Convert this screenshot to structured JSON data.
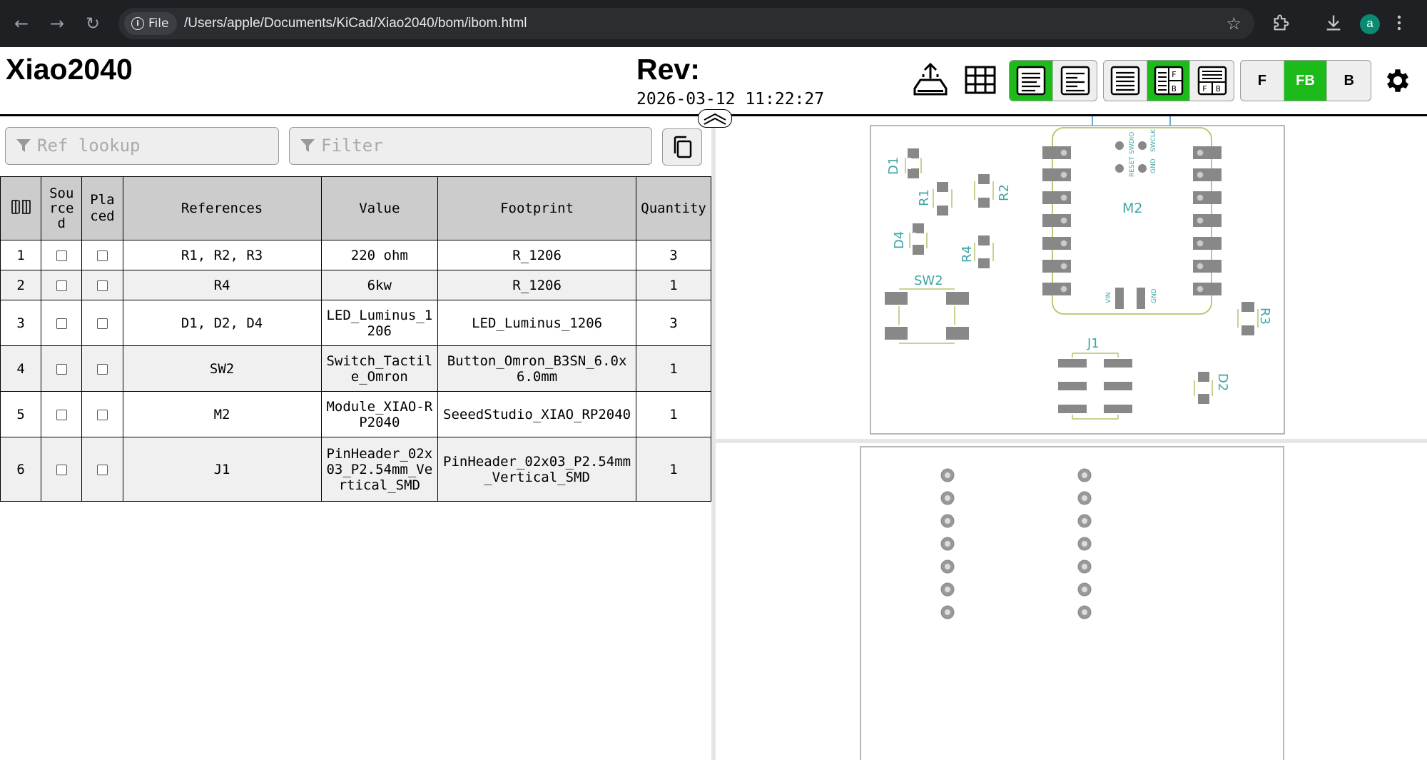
{
  "browser": {
    "file_chip": "File",
    "url": "/Users/apple/Documents/KiCad/Xiao2040/bom/ibom.html",
    "avatar_letter": "a"
  },
  "header": {
    "title": "Xiao2040",
    "rev_label": "Rev:",
    "date": "2026-03-12 11:22:27",
    "layers": {
      "front": "F",
      "both": "FB",
      "back": "B"
    },
    "accent_color": "#1dbb1a"
  },
  "filters": {
    "ref_lookup_placeholder": "Ref lookup",
    "filter_placeholder": "Filter"
  },
  "bom": {
    "headers": {
      "sourced": "Sourced",
      "placed": "Placed",
      "references": "References",
      "value": "Value",
      "footprint": "Footprint",
      "quantity": "Quantity"
    },
    "rows": [
      {
        "num": "1",
        "references": "R1, R2, R3",
        "value": "220 ohm",
        "footprint": "R_1206",
        "quantity": "3"
      },
      {
        "num": "2",
        "references": "R4",
        "value": "6kw",
        "footprint": "R_1206",
        "quantity": "1"
      },
      {
        "num": "3",
        "references": "D1, D2, D4",
        "value": "LED_Luminus_1206",
        "footprint": "LED_Luminus_1206",
        "quantity": "3"
      },
      {
        "num": "4",
        "references": "SW2",
        "value": "Switch_Tactile_Omron",
        "footprint": "Button_Omron_B3SN_6.0x6.0mm",
        "quantity": "1"
      },
      {
        "num": "5",
        "references": "M2",
        "value": "Module_XIAO-RP2040",
        "footprint": "SeeedStudio_XIAO_RP2040",
        "quantity": "1"
      },
      {
        "num": "6",
        "references": "J1",
        "value": "PinHeader_02x03_P2.54mm_Vertical_SMD",
        "footprint": "PinHeader_02x03_P2.54mm_Vertical_SMD",
        "quantity": "1"
      }
    ]
  },
  "pcb": {
    "labels": {
      "d1": "D1",
      "r1": "R1",
      "r2": "R2",
      "d4": "D4",
      "r4": "R4",
      "sw2": "SW2",
      "m2": "M2",
      "r3": "R3",
      "j1": "J1",
      "d2": "D2",
      "reset": "RESET",
      "swdio": "SWDIO",
      "gnd": "GND",
      "swclk": "SWCLK",
      "vin": "VIN"
    }
  }
}
